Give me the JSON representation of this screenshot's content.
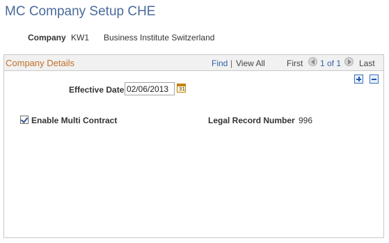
{
  "page": {
    "title": "MC Company Setup CHE"
  },
  "company": {
    "label": "Company",
    "code": "KW1",
    "name": "Business Institute Switzerland"
  },
  "details": {
    "title": "Company Details",
    "find_label": "Find",
    "separator": "|",
    "view_all_label": "View All",
    "first_label": "First",
    "page_indicator": "1 of 1",
    "last_label": "Last",
    "effective_date_label": "Effective Date",
    "effective_date_value": "02/06/2013",
    "enable_multi_contract_label": "Enable Multi Contract",
    "enable_multi_contract_checked": true,
    "legal_record_number_label": "Legal Record Number",
    "legal_record_number_value": "996"
  },
  "icons": {
    "prev": "left-arrow-icon",
    "next": "right-arrow-icon",
    "add": "add-row-icon",
    "delete": "delete-row-icon",
    "calendar": "calendar-icon"
  },
  "colors": {
    "title": "#4a6a9a",
    "section_title": "#c26e29",
    "link": "#2f5fa8"
  }
}
